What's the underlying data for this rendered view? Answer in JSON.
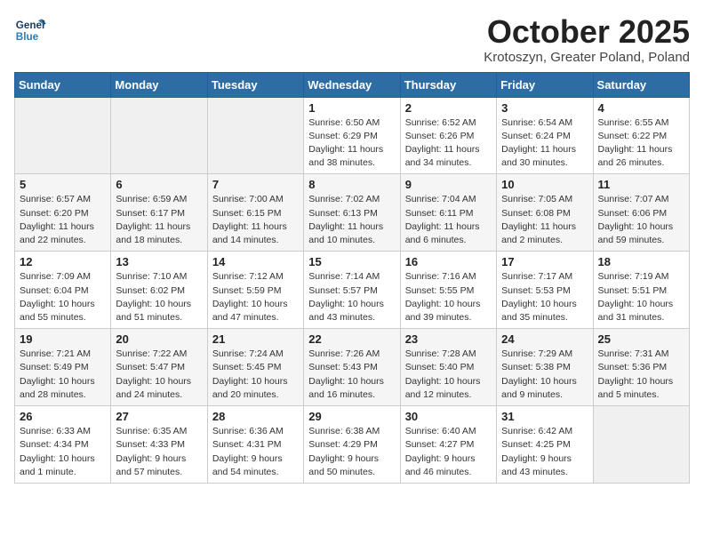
{
  "logo": {
    "line1": "General",
    "line2": "Blue"
  },
  "title": "October 2025",
  "subtitle": "Krotoszyn, Greater Poland, Poland",
  "days_of_week": [
    "Sunday",
    "Monday",
    "Tuesday",
    "Wednesday",
    "Thursday",
    "Friday",
    "Saturday"
  ],
  "weeks": [
    [
      {
        "day": "",
        "info": ""
      },
      {
        "day": "",
        "info": ""
      },
      {
        "day": "",
        "info": ""
      },
      {
        "day": "1",
        "info": "Sunrise: 6:50 AM\nSunset: 6:29 PM\nDaylight: 11 hours\nand 38 minutes."
      },
      {
        "day": "2",
        "info": "Sunrise: 6:52 AM\nSunset: 6:26 PM\nDaylight: 11 hours\nand 34 minutes."
      },
      {
        "day": "3",
        "info": "Sunrise: 6:54 AM\nSunset: 6:24 PM\nDaylight: 11 hours\nand 30 minutes."
      },
      {
        "day": "4",
        "info": "Sunrise: 6:55 AM\nSunset: 6:22 PM\nDaylight: 11 hours\nand 26 minutes."
      }
    ],
    [
      {
        "day": "5",
        "info": "Sunrise: 6:57 AM\nSunset: 6:20 PM\nDaylight: 11 hours\nand 22 minutes."
      },
      {
        "day": "6",
        "info": "Sunrise: 6:59 AM\nSunset: 6:17 PM\nDaylight: 11 hours\nand 18 minutes."
      },
      {
        "day": "7",
        "info": "Sunrise: 7:00 AM\nSunset: 6:15 PM\nDaylight: 11 hours\nand 14 minutes."
      },
      {
        "day": "8",
        "info": "Sunrise: 7:02 AM\nSunset: 6:13 PM\nDaylight: 11 hours\nand 10 minutes."
      },
      {
        "day": "9",
        "info": "Sunrise: 7:04 AM\nSunset: 6:11 PM\nDaylight: 11 hours\nand 6 minutes."
      },
      {
        "day": "10",
        "info": "Sunrise: 7:05 AM\nSunset: 6:08 PM\nDaylight: 11 hours\nand 2 minutes."
      },
      {
        "day": "11",
        "info": "Sunrise: 7:07 AM\nSunset: 6:06 PM\nDaylight: 10 hours\nand 59 minutes."
      }
    ],
    [
      {
        "day": "12",
        "info": "Sunrise: 7:09 AM\nSunset: 6:04 PM\nDaylight: 10 hours\nand 55 minutes."
      },
      {
        "day": "13",
        "info": "Sunrise: 7:10 AM\nSunset: 6:02 PM\nDaylight: 10 hours\nand 51 minutes."
      },
      {
        "day": "14",
        "info": "Sunrise: 7:12 AM\nSunset: 5:59 PM\nDaylight: 10 hours\nand 47 minutes."
      },
      {
        "day": "15",
        "info": "Sunrise: 7:14 AM\nSunset: 5:57 PM\nDaylight: 10 hours\nand 43 minutes."
      },
      {
        "day": "16",
        "info": "Sunrise: 7:16 AM\nSunset: 5:55 PM\nDaylight: 10 hours\nand 39 minutes."
      },
      {
        "day": "17",
        "info": "Sunrise: 7:17 AM\nSunset: 5:53 PM\nDaylight: 10 hours\nand 35 minutes."
      },
      {
        "day": "18",
        "info": "Sunrise: 7:19 AM\nSunset: 5:51 PM\nDaylight: 10 hours\nand 31 minutes."
      }
    ],
    [
      {
        "day": "19",
        "info": "Sunrise: 7:21 AM\nSunset: 5:49 PM\nDaylight: 10 hours\nand 28 minutes."
      },
      {
        "day": "20",
        "info": "Sunrise: 7:22 AM\nSunset: 5:47 PM\nDaylight: 10 hours\nand 24 minutes."
      },
      {
        "day": "21",
        "info": "Sunrise: 7:24 AM\nSunset: 5:45 PM\nDaylight: 10 hours\nand 20 minutes."
      },
      {
        "day": "22",
        "info": "Sunrise: 7:26 AM\nSunset: 5:43 PM\nDaylight: 10 hours\nand 16 minutes."
      },
      {
        "day": "23",
        "info": "Sunrise: 7:28 AM\nSunset: 5:40 PM\nDaylight: 10 hours\nand 12 minutes."
      },
      {
        "day": "24",
        "info": "Sunrise: 7:29 AM\nSunset: 5:38 PM\nDaylight: 10 hours\nand 9 minutes."
      },
      {
        "day": "25",
        "info": "Sunrise: 7:31 AM\nSunset: 5:36 PM\nDaylight: 10 hours\nand 5 minutes."
      }
    ],
    [
      {
        "day": "26",
        "info": "Sunrise: 6:33 AM\nSunset: 4:34 PM\nDaylight: 10 hours\nand 1 minute."
      },
      {
        "day": "27",
        "info": "Sunrise: 6:35 AM\nSunset: 4:33 PM\nDaylight: 9 hours\nand 57 minutes."
      },
      {
        "day": "28",
        "info": "Sunrise: 6:36 AM\nSunset: 4:31 PM\nDaylight: 9 hours\nand 54 minutes."
      },
      {
        "day": "29",
        "info": "Sunrise: 6:38 AM\nSunset: 4:29 PM\nDaylight: 9 hours\nand 50 minutes."
      },
      {
        "day": "30",
        "info": "Sunrise: 6:40 AM\nSunset: 4:27 PM\nDaylight: 9 hours\nand 46 minutes."
      },
      {
        "day": "31",
        "info": "Sunrise: 6:42 AM\nSunset: 4:25 PM\nDaylight: 9 hours\nand 43 minutes."
      },
      {
        "day": "",
        "info": ""
      }
    ]
  ]
}
